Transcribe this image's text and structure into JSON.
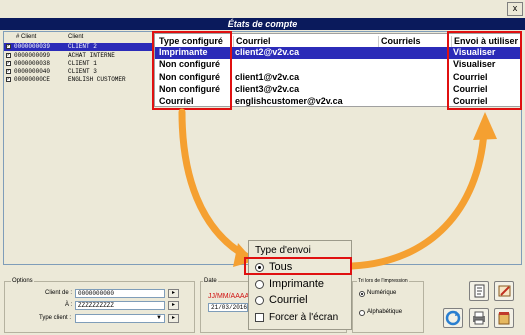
{
  "window": {
    "close_glyph": "x"
  },
  "banner": {
    "title": "États de compte"
  },
  "grid": {
    "headers": {
      "num_client": "# Client",
      "client": "Client"
    },
    "columns": {
      "type": "Type configuré",
      "courriel": "Courriel",
      "refuses": "Courriels refusés",
      "envoi": "Envoi à utiliser"
    },
    "rows": [
      {
        "num": "0000000039",
        "client": "CLIENT 2",
        "type": "Imprimante",
        "courriel": "client2@v2v.ca",
        "envoi": "Visualiser",
        "checked": true,
        "selected": true
      },
      {
        "num": "0000000099",
        "client": "ACHAT INTERNE",
        "type": "Non configuré",
        "courriel": "",
        "envoi": "Visualiser",
        "checked": true,
        "selected": false
      },
      {
        "num": "0000000038",
        "client": "CLIENT 1",
        "type": "Non configuré",
        "courriel": "client1@v2v.ca",
        "envoi": "Courriel",
        "checked": true,
        "selected": false
      },
      {
        "num": "0000000040",
        "client": "CLIENT 3",
        "type": "Non configuré",
        "courriel": "client3@v2v.ca",
        "envoi": "Courriel",
        "checked": true,
        "selected": false
      },
      {
        "num": "00000000CE",
        "client": "ENGLISH CUSTOMER",
        "type": "Courriel",
        "courriel": "englishcustomer@v2v.ca",
        "envoi": "Courriel",
        "checked": true,
        "selected": false
      }
    ]
  },
  "options": {
    "legend": "Options",
    "client_de_label": "Client de :",
    "client_de_value": "0000000000",
    "a_label": "À :",
    "a_value": "ZZZZZZZZZZ",
    "type_client_label": "Type client :",
    "type_client_value": ""
  },
  "date": {
    "legend": "Date",
    "format": "JJ/MM/AAAA",
    "value": "21/03/2016"
  },
  "type_envoi": {
    "legend": "Type d'envoi",
    "options": [
      "Tous",
      "Imprimante",
      "Courriel"
    ],
    "selected": "Tous",
    "force_label": "Forcer à l'écran"
  },
  "tri": {
    "legend": "Tri lors de l'impression",
    "options": [
      "Numérique",
      "Alphabétique"
    ],
    "selected": "Numérique"
  },
  "colors": {
    "highlight": "#e01010",
    "arrow": "#f5a031",
    "selection": "#2b2bb8",
    "banner": "#0a1a5c"
  },
  "icons": [
    "close-icon",
    "report-icon",
    "pen-icon",
    "refresh-icon",
    "printer-icon",
    "eraser-icon",
    "pick-icon",
    "checkbox-icon"
  ]
}
